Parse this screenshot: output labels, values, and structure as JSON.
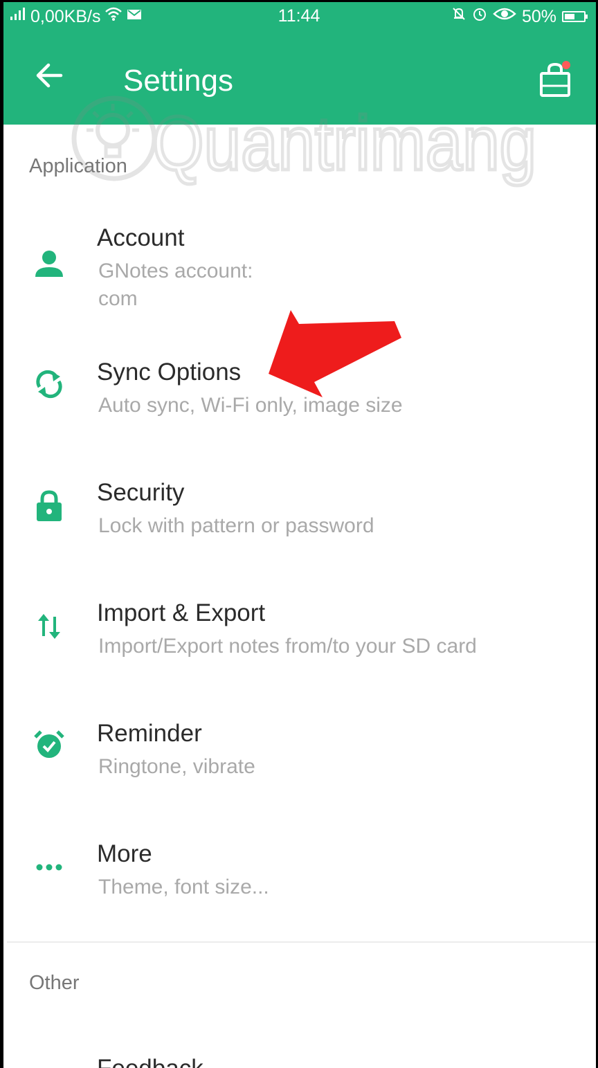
{
  "status_bar": {
    "network": "0,00KB/s",
    "time": "11:44",
    "battery": "50%"
  },
  "appbar": {
    "title": "Settings"
  },
  "watermark": {
    "text": "Quantrimang"
  },
  "sections": {
    "application": "Application",
    "other": "Other"
  },
  "items": [
    {
      "title": "Account",
      "subtitle_line1": "GNotes account:",
      "subtitle_line2": "com",
      "icon": "person-icon"
    },
    {
      "title": "Sync Options",
      "subtitle": "Auto sync, Wi-Fi only, image size",
      "icon": "sync-icon"
    },
    {
      "title": "Security",
      "subtitle": "Lock with pattern or password",
      "icon": "lock-icon"
    },
    {
      "title": "Import & Export",
      "subtitle": "Import/Export notes from/to your SD card",
      "icon": "import-export-icon"
    },
    {
      "title": "Reminder",
      "subtitle": "Ringtone, vibrate",
      "icon": "alarm-icon"
    },
    {
      "title": "More",
      "subtitle": "Theme, font size...",
      "icon": "more-icon"
    },
    {
      "title": "Feedback"
    }
  ],
  "colors": {
    "accent": "#22b47c",
    "annotation_arrow": "#ee1c1c",
    "subtitle": "#a9a9a9"
  }
}
